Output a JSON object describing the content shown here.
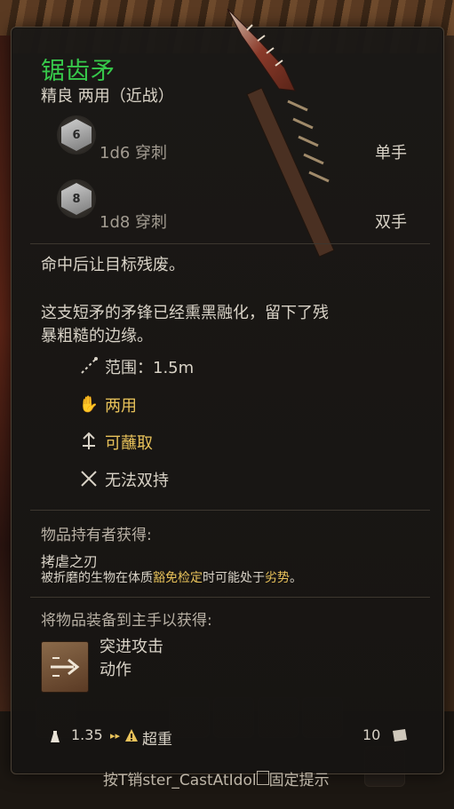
{
  "item": {
    "name": "锯齿矛",
    "subtitle": "精良 两用（近战）",
    "damage": [
      {
        "dice_face": "6",
        "value": "1d6 穿刺",
        "hand": "单手"
      },
      {
        "dice_face": "8",
        "value": "1d8 穿刺",
        "hand": "双手"
      }
    ],
    "effect": "命中后让目标残废。",
    "description_line1": "这支短矛的矛锋已经熏黑融化，留下了残",
    "description_line2": "暴粗糙的边缘。",
    "properties": [
      {
        "icon": "range-icon",
        "label": "范围：1.5m",
        "highlight": false
      },
      {
        "icon": "hand-icon",
        "label": "两用",
        "highlight": true
      },
      {
        "icon": "dip-icon",
        "label": "可蘸取",
        "highlight": true
      },
      {
        "icon": "no-dual-wield-icon",
        "label": "无法双持",
        "highlight": false
      }
    ],
    "holder_header": "物品持有者获得:",
    "holder_passive_name": "拷虐之刃",
    "holder_passive_pre": "被折磨的生物在体质",
    "holder_passive_save": "豁免检定",
    "holder_passive_mid": "时可能处于",
    "holder_passive_disadv": "劣势",
    "holder_passive_end": "。",
    "equip_header": "将物品装备到主手以获得:",
    "action_name": "突进攻击",
    "action_type": "动作",
    "weight": "1.35",
    "weight_status": "超重",
    "value": "10",
    "footer_pre": "按T销ster_CastAtIdol",
    "footer_post": "固定提示"
  },
  "colors": {
    "name": "#37c94b",
    "highlight": "#e8c25a"
  }
}
